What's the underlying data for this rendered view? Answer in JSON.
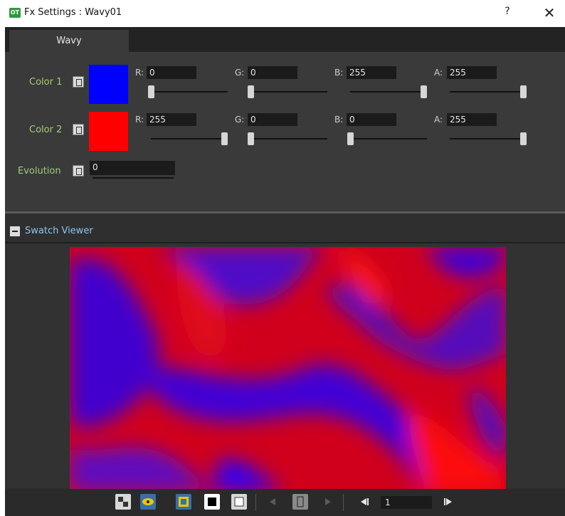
{
  "window": {
    "title": "Fx Settings : Wavy01",
    "app_icon_text": "OT",
    "help_label": "?",
    "close_label": "✕"
  },
  "tabs": [
    {
      "label": "Wavy"
    }
  ],
  "params": {
    "color1": {
      "label": "Color 1",
      "swatch": "#0000ff",
      "channels": [
        {
          "name": "R:",
          "value": "0"
        },
        {
          "name": "G:",
          "value": "0"
        },
        {
          "name": "B:",
          "value": "255"
        },
        {
          "name": "A:",
          "value": "255"
        }
      ]
    },
    "color2": {
      "label": "Color 2",
      "swatch": "#ff0000",
      "channels": [
        {
          "name": "R:",
          "value": "255"
        },
        {
          "name": "G:",
          "value": "0"
        },
        {
          "name": "B:",
          "value": "0"
        },
        {
          "name": "A:",
          "value": "255"
        }
      ]
    },
    "evolution": {
      "label": "Evolution",
      "value": "0"
    }
  },
  "viewer": {
    "title": "Swatch Viewer",
    "frame_value": "1",
    "colors": {
      "a": "#ff0000",
      "b": "#2200ff",
      "blend": "#8a1aa8"
    }
  },
  "toolbar": {
    "buttons": [
      "checkerboard-icon",
      "eye-icon",
      "preview-frame-icon",
      "black-bg-icon",
      "white-bg-icon",
      "prev-icon",
      "key-icon",
      "next-icon",
      "first-frame-icon",
      "last-frame-icon"
    ],
    "active_color": "#e8c800",
    "prev_frame_label": "◀|",
    "next_frame_label": "|▶"
  }
}
